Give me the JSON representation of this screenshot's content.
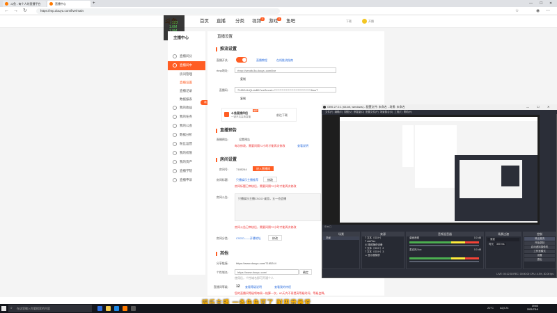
{
  "browser": {
    "tabs": [
      {
        "label": "斗鱼 - 每个人的直播平台",
        "active": false
      },
      {
        "label": "直播中心",
        "active": true
      }
    ],
    "new_tab": "+",
    "url": "https://mp.douyu.com/live/main"
  },
  "site": {
    "logo": "斗鱼",
    "nav": [
      {
        "label": "首页",
        "active": false
      },
      {
        "label": "直播",
        "active": false
      },
      {
        "label": "分类",
        "active": false
      },
      {
        "label": "视频",
        "active": false,
        "badge": "●"
      },
      {
        "label": "游戏",
        "active": false,
        "badge": "●"
      },
      {
        "label": "鱼吧",
        "active": false
      }
    ],
    "header_right": [
      "下载",
      "开播"
    ],
    "overlay": {
      "line1": "↑ 123",
      "line2": "1.6M",
      "line3": "1.9M"
    }
  },
  "sidebar": {
    "title": "主播中心",
    "items": [
      {
        "label": "直播间分",
        "active": false
      },
      {
        "label": "直播间中",
        "active": true
      },
      {
        "label": "房间管理",
        "sub": true,
        "active": false
      },
      {
        "label": "直播设置",
        "sub": true,
        "active": true
      },
      {
        "label": "直播记录",
        "sub": true,
        "active": false
      },
      {
        "label": "数据报表",
        "sub": true,
        "active": false
      },
      {
        "label": "我的收益",
        "active": false
      },
      {
        "label": "我的任务",
        "active": false
      },
      {
        "label": "我的公会",
        "active": false
      },
      {
        "label": "数据分析",
        "active": false
      },
      {
        "label": "粉丝运营",
        "active": false
      },
      {
        "label": "我的权限",
        "active": false
      },
      {
        "label": "我的资产",
        "active": false
      },
      {
        "label": "直播学院",
        "active": false
      },
      {
        "label": "直播申诉",
        "active": false
      }
    ],
    "float_badge": "新"
  },
  "main": {
    "page_title": "直播设置",
    "stream": {
      "section": "推流设置",
      "push_label": "直播开关:",
      "push_link1": "直播教程",
      "push_link2": "在线推流指南",
      "rtmp_label": "rtmp地址:",
      "rtmp_value": "rtmp://sendtc3a.douyu.com/live",
      "copy1": "复制",
      "code_label": "直播码:",
      "code_value": "7185244rQLdaB6?wsSecret=**********************************&wsT",
      "copy2": "复制",
      "promo_title": "斗鱼直播伴侣",
      "promo_sub": "一键开启高清直播",
      "promo_badge": "推荐",
      "promo_download": "前往下载"
    },
    "preview": {
      "section": "直播预告",
      "label": "直播预告:",
      "value": "设置预告",
      "warn": "每次修改，需要间隔72小时才能再次修改",
      "link": "查看说明"
    },
    "room": {
      "section": "房间设置",
      "id_label": "房间号:",
      "id_value": "7185244",
      "id_btn": "进入直播间",
      "name_label": "房间标题:",
      "name_value": "只播娱乐主播推荐",
      "name_btn": "修改",
      "name_warn": "房间标题已审核后，需要间隔72小时才能再次修改",
      "notice_label": "房间公告:",
      "notice_value": "只播娱乐主播CSGO·桌游，五一也会播",
      "notice_warn": "房间公告已审核后，需要间隔72小时才能再次修改",
      "cat_label": "房间分类:",
      "cat_value": "CSGO——开播地址",
      "cat_btn": "修改"
    },
    "other": {
      "section": "其他",
      "share_label": "分享链接:",
      "share_value": "https://www.douyu.com/7185244",
      "domain_label": "个性域名:",
      "domain_value": "https://www.douyu.com/",
      "domain_suffix": "确定",
      "domain_tip": "使用后，个性域名即可开通个人",
      "level_label": "直播间等级:",
      "level_value": "12",
      "level_link1": "查看等级说明",
      "level_link2": "查看我的特权",
      "level_tip": "您的直播间等级将每周一结算一次，60天内不再提高等级时间，等级会降。"
    }
  },
  "obs": {
    "title": "OBS 27.0.1 (64-bit, windows) - 配置文件: 未命名 - 场景: 未命名",
    "menu": [
      "文件(F)",
      "编辑(E)",
      "视图(V)",
      "停靠窗(D)",
      "配置文件(P)",
      "场景集合(S)",
      "工具(T)",
      "帮助(H)"
    ],
    "scenes_header": "场景",
    "scene": "场景",
    "sources_header": "来源",
    "sources": [
      "文本（GDI+）",
      "winPlan",
      "视频捕获设备",
      "文本（GDI+）2",
      "文本（GDI+）3",
      "显示器捕获"
    ],
    "mixer_header": "音频混音器",
    "mixer": [
      {
        "name": "桌面音频",
        "db": "0.0 dB"
      },
      {
        "name": "麦克风/Aux",
        "db": "0.0 dB"
      }
    ],
    "transitions_header": "场景过渡",
    "transition": "渐变",
    "duration_label": "时长",
    "duration": "300 ms",
    "controls_header": "控制",
    "controls": [
      "停止推流",
      "开始录制",
      "启动虚拟摄像机",
      "工作室模式",
      "设置",
      "退出"
    ],
    "status": "LIVE: 00:12:35   REC: 00:00:00   CPU: 4.3%, 30.00 fps"
  },
  "taskbar": {
    "search": "在这里输入你要搜索的内容",
    "weather": "22°C",
    "ime": "AQI 24",
    "time": "19:46",
    "date": "2021/7/16"
  },
  "stream_subtitle": "娱乐主播  一条鱼鱼豆了  耐思我最爱"
}
